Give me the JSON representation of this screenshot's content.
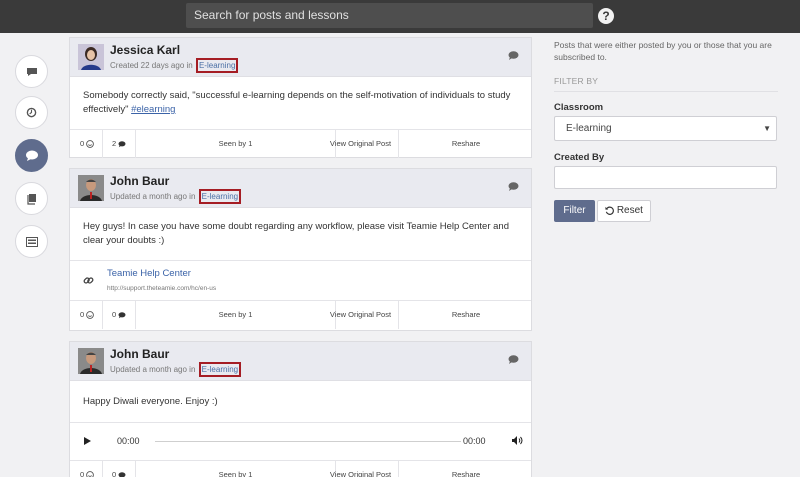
{
  "search": {
    "placeholder": "Search for posts and lessons"
  },
  "help_label": "?",
  "rail": [
    "messages-icon",
    "clock-icon",
    "discussion-icon",
    "book-icon",
    "list-icon"
  ],
  "posts": [
    {
      "author": "Jessica Karl",
      "time": "Created 22 days ago in",
      "classroom": "E-learning",
      "body": "Somebody correctly said, \"successful e-learning depends on the self-motivation of individuals to study effectively\"",
      "hashtag": "#elearning",
      "likes": "0",
      "comments": "2",
      "seen": "Seen by 1",
      "view": "View Original Post",
      "reshare": "Reshare"
    },
    {
      "author": "John Baur",
      "time": "Updated a month ago in",
      "classroom": "E-learning",
      "body": "Hey guys! In case you have some doubt regarding any workflow, please visit Teamie Help Center and clear your doubts :)",
      "link_title": "Teamie Help Center",
      "link_url": "http://support.theteamie.com/hc/en-us",
      "likes": "0",
      "comments": "0",
      "seen": "Seen by 1",
      "view": "View Original Post",
      "reshare": "Reshare"
    },
    {
      "author": "John Baur",
      "time": "Updated a month ago in",
      "classroom": "E-learning",
      "body": "Happy Diwali everyone. Enjoy :)",
      "audio_start": "00:00",
      "audio_end": "00:00",
      "likes": "0",
      "comments": "0",
      "seen": "Seen by 1",
      "view": "View Original Post",
      "reshare": "Reshare"
    }
  ],
  "sidebar": {
    "description": "Posts that were either posted by you or those that you are subscribed to.",
    "filter_by": "FILTER BY",
    "classroom_label": "Classroom",
    "classroom_value": "E-learning",
    "created_by_label": "Created By",
    "created_by_value": "",
    "filter_button": "Filter",
    "reset_button": "Reset"
  },
  "colors": {
    "topbar": "#3a3a3a",
    "accent": "#5f6c8d",
    "highlight_box": "#a51d24",
    "link": "#3b63a8"
  }
}
